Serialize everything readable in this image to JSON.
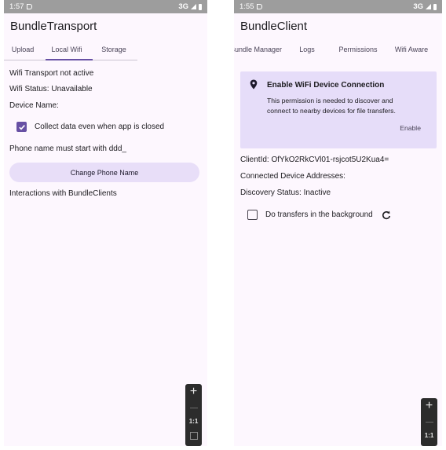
{
  "left": {
    "status": {
      "time": "1:57",
      "network": "3G"
    },
    "title": "BundleTransport",
    "tabs": [
      {
        "label": "Upload",
        "active": false
      },
      {
        "label": "Local Wifi",
        "active": true
      },
      {
        "label": "Storage",
        "active": false
      }
    ],
    "wifi_transport": "Wifi Transport not active",
    "wifi_status": "Wifi Status: Unavailable",
    "device_name": "Device Name:",
    "collect_checkbox": {
      "label": "Collect data even when app is closed",
      "checked": true
    },
    "phone_hint": "Phone name must start with ddd_",
    "change_button": "Change Phone Name",
    "interactions": "Interactions with BundleClients",
    "zoom": {
      "plus": "+",
      "ratio": "1:1"
    }
  },
  "right": {
    "status": {
      "time": "1:55",
      "network": "3G"
    },
    "title": "BundleClient",
    "tabs": [
      {
        "label": "Bundle Manager",
        "active": false
      },
      {
        "label": "Logs",
        "active": false
      },
      {
        "label": "Permissions",
        "active": true
      },
      {
        "label": "Wifi Aware",
        "active": false
      }
    ],
    "card": {
      "title": "Enable WiFi Device Connection",
      "text_line1": "This permission is needed to discover and",
      "text_line2": "connect to nearby devices for file transfers.",
      "action": "Enable"
    },
    "client_id": "ClientId: OfYkO2RkCVl01-rsjcot5U2Kua4=",
    "connected": "Connected Device Addresses:",
    "discovery": "Discovery Status: Inactive",
    "bg_checkbox": {
      "label": "Do transfers in the background",
      "checked": false
    },
    "zoom": {
      "plus": "+",
      "ratio": "1:1"
    }
  },
  "colors": {
    "accent": "#6750a4",
    "card": "#e6ddf9",
    "button": "#e8def8",
    "background": "#fdf7fe"
  },
  "icons": [
    "do-not-disturb-icon",
    "signal-icon",
    "battery-icon",
    "check-icon",
    "location-pin-icon",
    "refresh-icon",
    "zoom-plus-icon",
    "zoom-fit-icon"
  ]
}
